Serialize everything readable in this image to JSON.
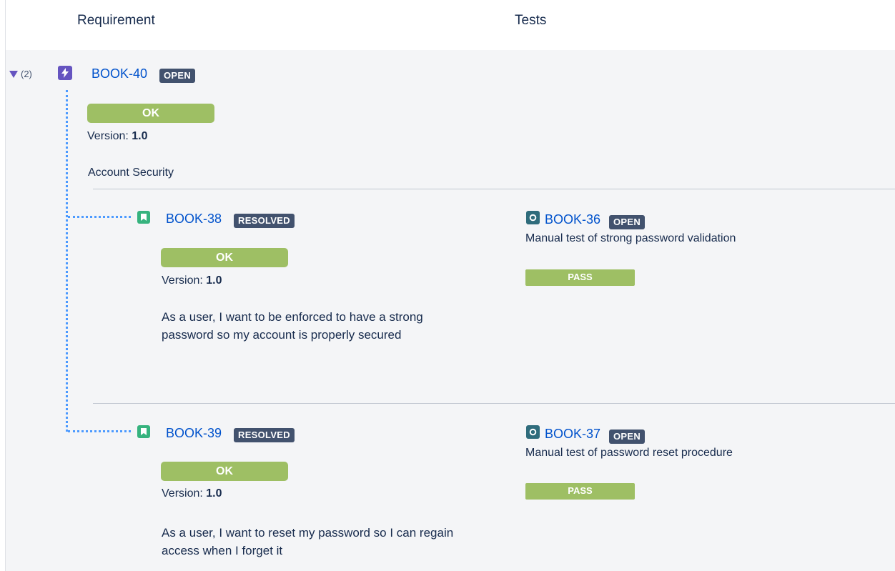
{
  "columns": {
    "requirement": "Requirement",
    "tests": "Tests"
  },
  "parent": {
    "child_count": "(2)",
    "key": "BOOK-40",
    "status": "OPEN",
    "coverage": "OK",
    "version_label": "Version:",
    "version": "1.0",
    "summary": "Account Security",
    "icon": "epic-icon"
  },
  "children": [
    {
      "key": "BOOK-38",
      "status": "RESOLVED",
      "coverage": "OK",
      "version_label": "Version:",
      "version": "1.0",
      "description": "As a user, I want to be enforced to have a strong password so my account is properly secured",
      "icon": "story-icon",
      "test": {
        "key": "BOOK-36",
        "status": "OPEN",
        "summary": "Manual test of strong password validation",
        "result": "PASS",
        "icon": "test-icon"
      }
    },
    {
      "key": "BOOK-39",
      "status": "RESOLVED",
      "coverage": "OK",
      "version_label": "Version:",
      "version": "1.0",
      "description": "As a user, I want to reset my password so I can regain access when I forget it",
      "icon": "story-icon",
      "test": {
        "key": "BOOK-37",
        "status": "OPEN",
        "summary": "Manual test of password reset procedure",
        "result": "PASS",
        "icon": "test-icon"
      }
    }
  ],
  "colors": {
    "link": "#0052cc",
    "ok": "#9ebf64",
    "lozenge": "#42526e",
    "epic": "#6554c0",
    "story": "#36b37e",
    "test": "#2f6c7c",
    "tree_line": "#4c9aff"
  }
}
